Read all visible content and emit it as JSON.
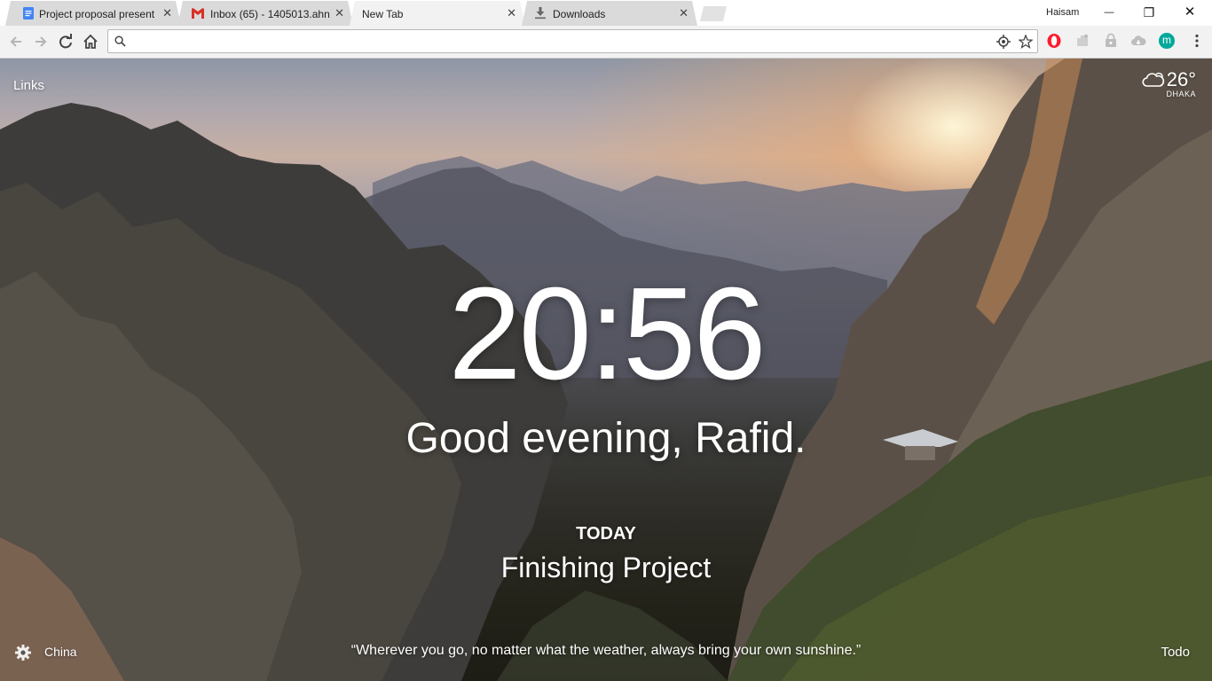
{
  "browser": {
    "tabs": [
      {
        "title": "Project proposal present",
        "icon": "google-docs-icon",
        "active": false
      },
      {
        "title": "Inbox (65) - 1405013.ahn",
        "icon": "gmail-icon",
        "active": false
      },
      {
        "title": "New Tab",
        "icon": "",
        "active": true
      },
      {
        "title": "Downloads",
        "icon": "download-icon",
        "active": false
      }
    ],
    "tab_close": "✕",
    "profile_name": "Haisam",
    "window_controls": {
      "minimize": "—",
      "restore": "❐",
      "close": "✕"
    },
    "omnibox": {
      "value": "",
      "placeholder": ""
    },
    "extensions": [
      "opera-icon",
      "puzzle-extension-icon",
      "lock-extension-icon",
      "cloud-extension-icon",
      "m-avatar-icon"
    ],
    "avatar_letter": "m"
  },
  "page": {
    "links_label": "Links",
    "weather": {
      "temp": "26°",
      "city": "DHAKA",
      "icon": "cloud-icon"
    },
    "clock": "20:56",
    "greeting": "Good evening, Rafid.",
    "focus_label": "TODAY",
    "focus_text": "Finishing Project",
    "photo_location": "China",
    "quote": "“Wherever you go, no matter what the weather, always bring your own sunshine.”",
    "todo_label": "Todo"
  },
  "colors": {
    "tab_inactive": "#dadada",
    "tab_active": "#f2f2f2",
    "toolbar": "#f2f2f2",
    "docs_blue": "#4285f4",
    "gmail_red": "#d93025",
    "opera_red": "#ff1b2d",
    "avatar_teal": "#00a89a"
  }
}
